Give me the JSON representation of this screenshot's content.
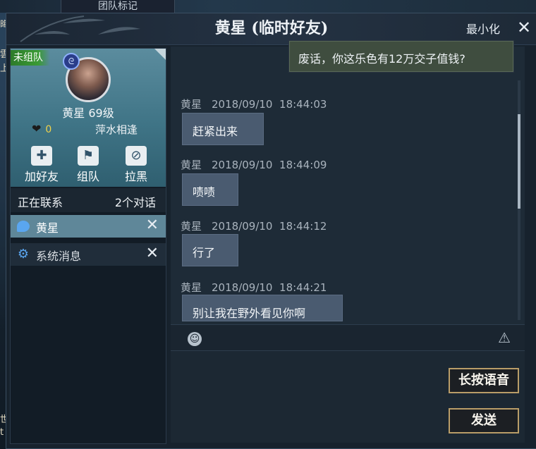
{
  "background": {
    "team_mark_tab": "团队标记",
    "left_edge_glyphs": [
      "晦",
      "雲",
      "上",
      "世",
      "t"
    ]
  },
  "window": {
    "title": "黄星 (临时好友)",
    "minimize_label": "最小化",
    "close_icon": "close-icon"
  },
  "profile": {
    "team_badge": "未组队",
    "name_level": "黄星  69级",
    "favor": "0",
    "location": "萍水相逢",
    "actions": [
      {
        "label": "加好友",
        "icon": "add-friend-icon"
      },
      {
        "label": "组队",
        "icon": "team-up-icon"
      },
      {
        "label": "拉黑",
        "icon": "block-icon"
      }
    ]
  },
  "contacts": {
    "header_label": "正在联系",
    "count_label": "2个对话",
    "items": [
      {
        "name": "黄星",
        "icon": "chat-bubble-icon",
        "active": true
      },
      {
        "name": "系统消息",
        "icon": "gear-icon",
        "active": false
      }
    ]
  },
  "chat": {
    "self_message": "废话，你这乐色有12万交子值钱?",
    "messages": [
      {
        "sender": "黄星",
        "date": "2018/09/10",
        "time": "18:44:03",
        "text": "赶紧出来"
      },
      {
        "sender": "黄星",
        "date": "2018/09/10",
        "time": "18:44:09",
        "text": "啧啧"
      },
      {
        "sender": "黄星",
        "date": "2018/09/10",
        "time": "18:44:12",
        "text": "行了"
      },
      {
        "sender": "黄星",
        "date": "2018/09/10",
        "time": "18:44:21",
        "text": "别让我在野外看见你啊"
      }
    ]
  },
  "input": {
    "voice_button_label": "长按语音",
    "send_button_label": "发送"
  },
  "colors": {
    "accent_gold": "#b99d68",
    "team_green": "#3a9a34",
    "profile_teal": "#3f7486",
    "active_contact": "#5f8799"
  }
}
